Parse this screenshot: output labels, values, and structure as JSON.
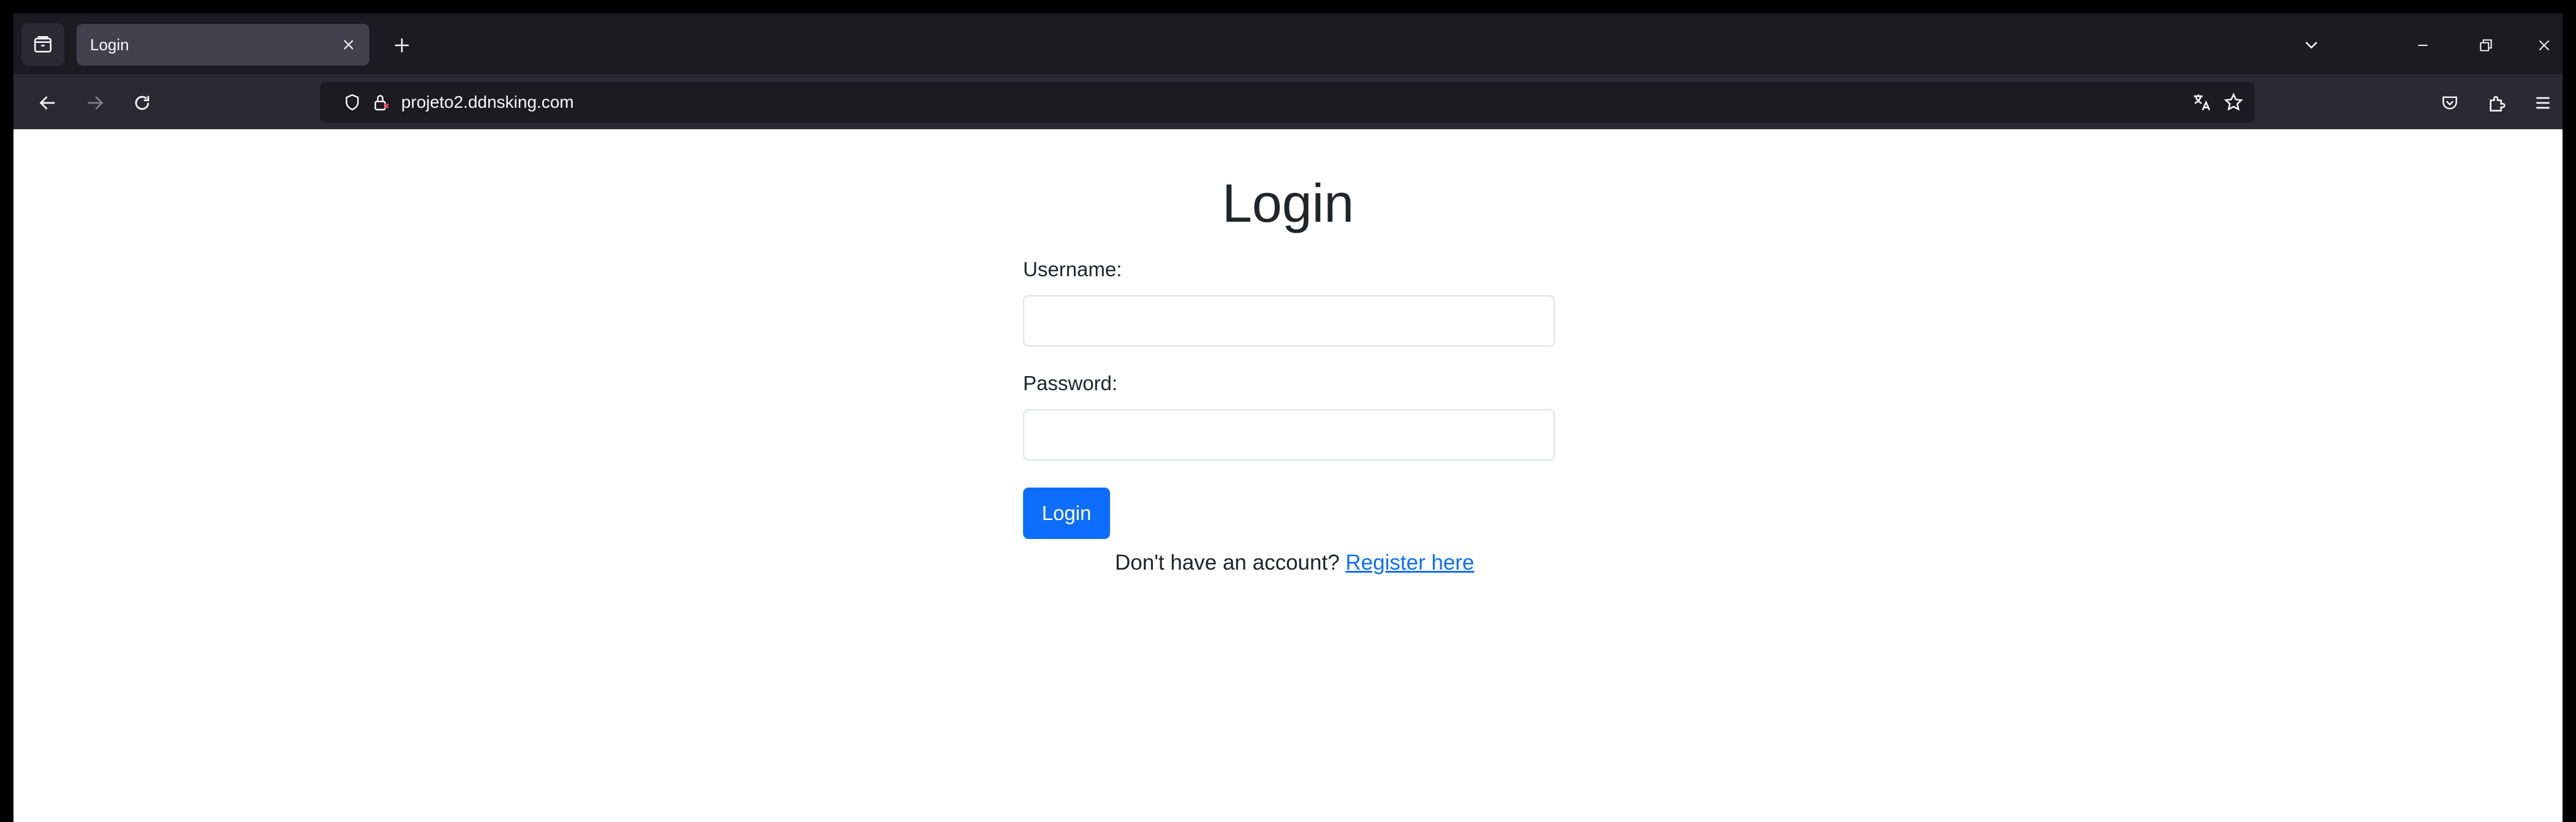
{
  "browser": {
    "tab_title": "Login",
    "url": "projeto2.ddnsking.com",
    "icons": {
      "tab_list": "tab-list-icon",
      "tab_close": "close-icon",
      "new_tab": "plus-icon",
      "tabs_overflow": "chevron-down-icon",
      "minimize": "minimize-icon",
      "restore": "restore-icon",
      "window_close": "close-icon",
      "back": "arrow-left-icon",
      "forward": "arrow-right-icon",
      "reload": "reload-icon",
      "tracking_protection": "shield-icon",
      "connection": "lock-icon",
      "translate": "translate-icon",
      "bookmark": "star-icon",
      "pocket": "pocket-icon",
      "extensions": "puzzle-icon",
      "menu": "hamburger-icon"
    }
  },
  "page": {
    "title": "Login",
    "username_label": "Username:",
    "username_value": "",
    "password_label": "Password:",
    "password_value": "",
    "submit_label": "Login",
    "register_prompt": "Don't have an account? ",
    "register_link": "Register here",
    "colors": {
      "primary": "#0d6efd",
      "text": "#212529",
      "border": "#dee2e6"
    }
  }
}
